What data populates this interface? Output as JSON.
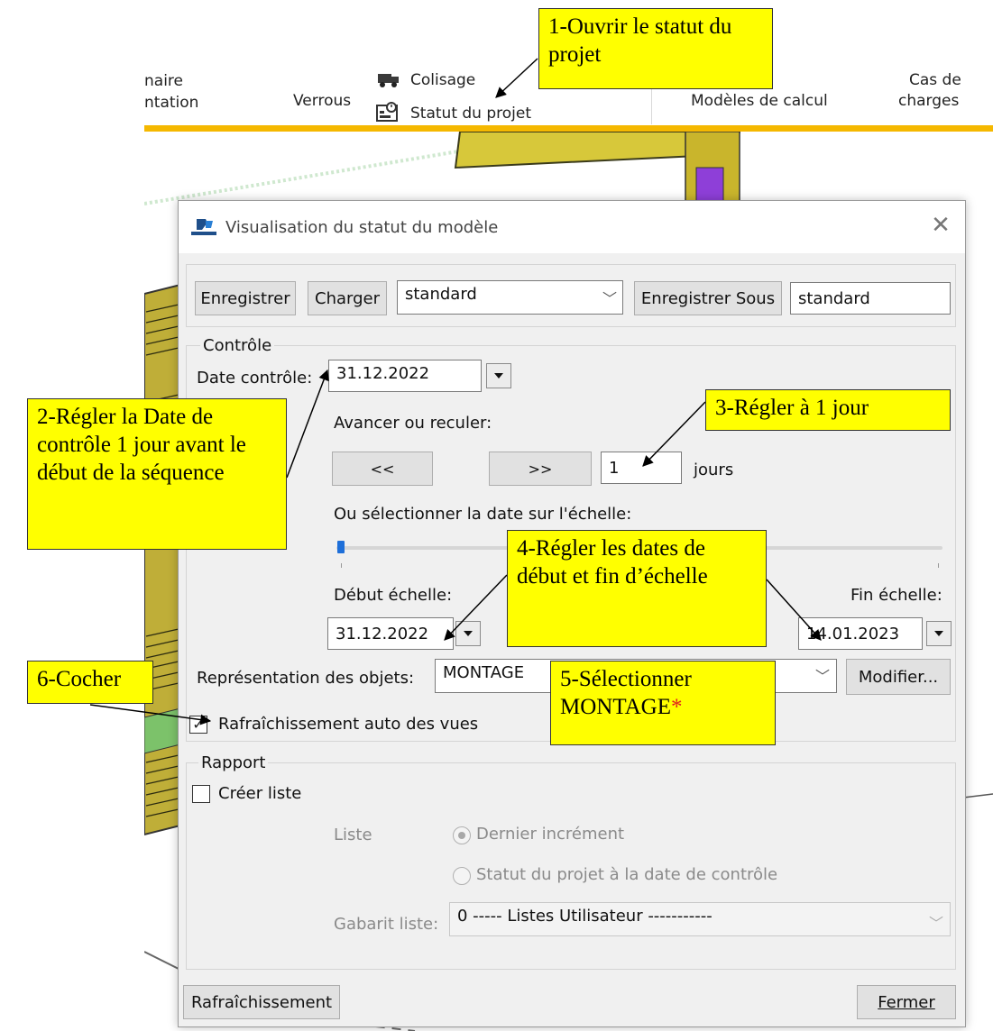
{
  "ribbon": {
    "item1_line1": "naire",
    "item1_line2": "ntation",
    "verrous": "Verrous",
    "colisage": "Colisage",
    "statut_projet": "Statut du projet",
    "modeles_calcul": "Modèles de calcul",
    "cas_line1": "Cas de",
    "cas_line2": "charges"
  },
  "dialog": {
    "title": "Visualisation du statut du modèle",
    "close_glyph": "✕",
    "top": {
      "save": "Enregistrer",
      "load": "Charger",
      "preset": "standard",
      "save_as": "Enregistrer Sous",
      "save_as_name": "standard"
    },
    "controle": {
      "group_label": "Contrôle",
      "date_label": "Date contrôle:",
      "date_value": "31.12.2022",
      "avancer_label": "Avancer ou reculer:",
      "back_btn": "<<",
      "fwd_btn": ">>",
      "days_value": "1",
      "days_unit": "jours",
      "scale_label": "Ou sélectionner la date sur l'échelle:",
      "slider_position": 0.0,
      "debut_label": "Début échelle:",
      "debut_value": "31.12.2022",
      "fin_label": "Fin échelle:",
      "fin_value": "14.01.2023",
      "repr_label": "Représentation des objets:",
      "repr_value": "MONTAGE",
      "modifier_btn": "Modifier...",
      "auto_refresh_label": "Rafraîchissement auto des vues",
      "auto_refresh_checked": true
    },
    "rapport": {
      "group_label": "Rapport",
      "create_list_label": "Créer liste",
      "create_list_checked": false,
      "liste_label": "Liste",
      "radio1": "Dernier incrément",
      "radio2": "Statut du projet à la date de contrôle",
      "gabarit_label": "Gabarit liste:",
      "gabarit_value": "0 ----- Listes Utilisateur -----------"
    },
    "bottom": {
      "refresh_btn": "Rafraîchissement",
      "close_btn": "Fermer"
    }
  },
  "callouts": {
    "c1": "1-Ouvrir le statut du projet",
    "c2": "2-Régler la Date de contrôle 1 jour avant le début de la séquence",
    "c3": "3-Régler à 1 jour",
    "c4": "4-Régler les dates de début et fin d’échelle",
    "c5": "5-Sélectionner MONTAGE",
    "c5_star": "*",
    "c6": "6-Cocher"
  },
  "colors": {
    "ribbon_accent": "#f5b800",
    "callout_bg": "#ffff00",
    "dialog_bg": "#f0f0f0",
    "star": "#e02020",
    "slider_thumb": "#1e6fd9"
  }
}
